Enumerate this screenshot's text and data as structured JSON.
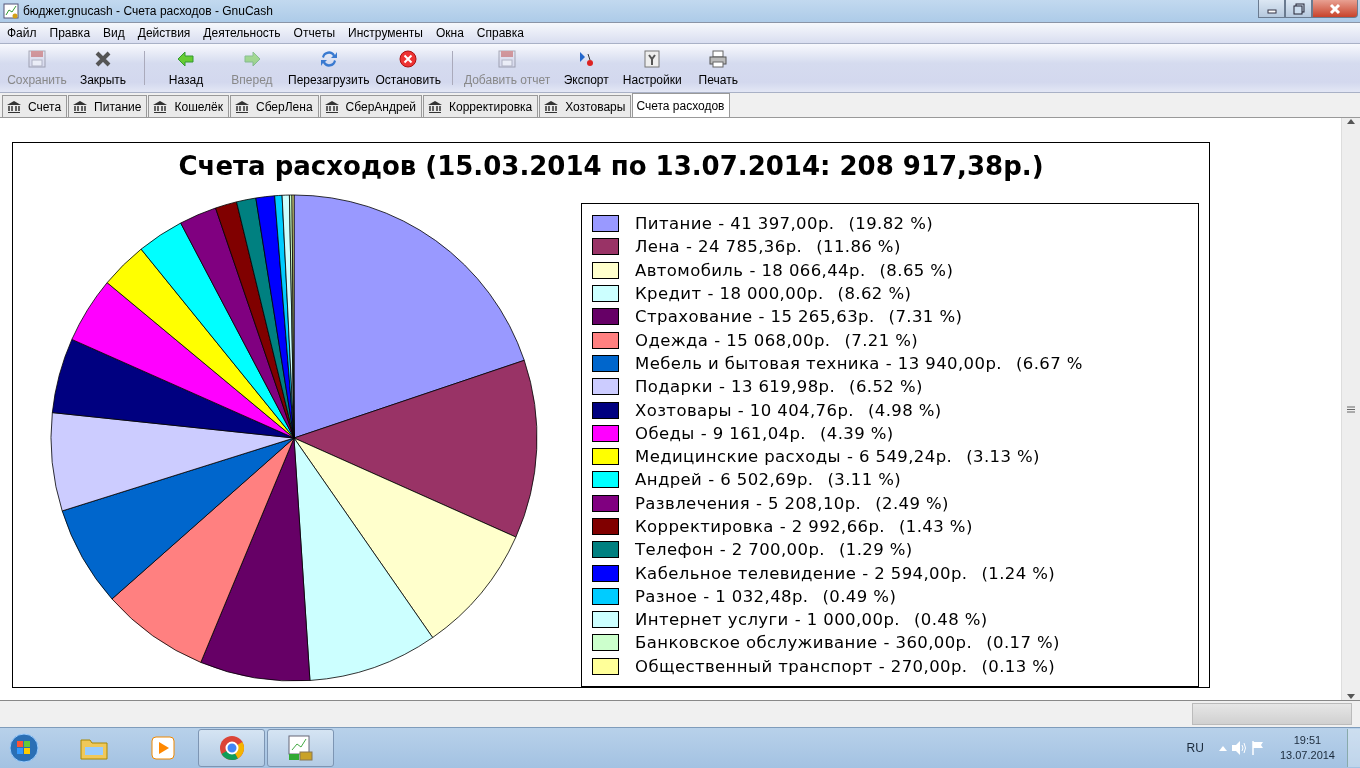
{
  "window": {
    "title": "бюджет.gnucash - Счета расходов - GnuCash"
  },
  "menu": [
    {
      "label": "Файл"
    },
    {
      "label": "Правка"
    },
    {
      "label": "Вид"
    },
    {
      "label": "Действия"
    },
    {
      "label": "Деятельность"
    },
    {
      "label": "Отчеты"
    },
    {
      "label": "Инструменты"
    },
    {
      "label": "Окна"
    },
    {
      "label": "Справка"
    }
  ],
  "toolbar": [
    {
      "label": "Сохранить",
      "kind": "save",
      "disabled": true
    },
    {
      "label": "Закрыть",
      "kind": "close",
      "disabled": false,
      "separator_after": true
    },
    {
      "label": "Назад",
      "kind": "back",
      "disabled": false
    },
    {
      "label": "Вперед",
      "kind": "forward",
      "disabled": true
    },
    {
      "label": "Перезагрузить",
      "kind": "reload",
      "disabled": false
    },
    {
      "label": "Остановить",
      "kind": "stop",
      "disabled": false,
      "separator_after": true
    },
    {
      "label": "Добавить отчет",
      "kind": "save",
      "disabled": true
    },
    {
      "label": "Экспорт",
      "kind": "export",
      "disabled": false
    },
    {
      "label": "Настройки",
      "kind": "options",
      "disabled": false
    },
    {
      "label": "Печать",
      "kind": "print",
      "disabled": false
    }
  ],
  "tabs": [
    {
      "label": "Счета",
      "kind": "account",
      "selected": false
    },
    {
      "label": "Питание",
      "kind": "account",
      "selected": false
    },
    {
      "label": "Кошелёк",
      "kind": "account",
      "selected": false
    },
    {
      "label": "СберЛена",
      "kind": "account",
      "selected": false
    },
    {
      "label": "СберАндрей",
      "kind": "account",
      "selected": false
    },
    {
      "label": "Корректировка",
      "kind": "account",
      "selected": false
    },
    {
      "label": "Хозтовары",
      "kind": "account",
      "selected": false
    },
    {
      "label": "Счета расходов",
      "kind": "report",
      "selected": true
    }
  ],
  "report": {
    "chart_data": {
      "type": "pie",
      "title": "Счета расходов (15.03.2014 по 13.07.2014: 208 917,38р.)",
      "categories": [
        "Питание",
        "Лена",
        "Автомобиль",
        "Кредит",
        "Страхование",
        "Одежда",
        "Мебель и бытовая техника",
        "Подарки",
        "Хозтовары",
        "Обеды",
        "Медицинские расходы",
        "Андрей",
        "Развлечения",
        "Корректировка",
        "Телефон",
        "Кабельное телевидение",
        "Разное",
        "Интернет услуги",
        "Банковское обслуживание",
        "Общественный транспорт"
      ],
      "legend": "right",
      "values": [
        19.82,
        11.86,
        8.65,
        8.62,
        7.31,
        7.21,
        6.67,
        6.52,
        4.98,
        4.39,
        3.13,
        3.11,
        2.49,
        1.43,
        1.29,
        1.24,
        0.49,
        0.48,
        0.17,
        0.13
      ]
    },
    "legend": [
      {
        "amount": "- 41 397,00р.",
        "percent": "(19.82 %)",
        "color": "#9999ff"
      },
      {
        "amount": "- 24 785,36р.",
        "percent": "(11.86 %)",
        "color": "#993366"
      },
      {
        "amount": "- 18 066,44р.",
        "percent": "(8.65 %)",
        "color": "#ffffcc"
      },
      {
        "amount": "- 18 000,00р.",
        "percent": "(8.62 %)",
        "color": "#ccffff"
      },
      {
        "amount": "- 15 265,63р.",
        "percent": "(7.31 %)",
        "color": "#660066"
      },
      {
        "amount": "- 15 068,00р.",
        "percent": "(7.21 %)",
        "color": "#ff8080"
      },
      {
        "amount": "- 13 940,00р.",
        "percent": "(6.67 %",
        "color": "#0066cc"
      },
      {
        "amount": "- 13 619,98р.",
        "percent": "(6.52 %)",
        "color": "#ccccff"
      },
      {
        "amount": "- 10 404,76р.",
        "percent": "(4.98 %)",
        "color": "#000080"
      },
      {
        "amount": "- 9 161,04р.",
        "percent": "(4.39 %)",
        "color": "#ff00ff"
      },
      {
        "amount": "- 6 549,24р.",
        "percent": "(3.13 %)",
        "color": "#ffff00"
      },
      {
        "amount": "- 6 502,69р.",
        "percent": "(3.11 %)",
        "color": "#00ffff"
      },
      {
        "amount": "- 5 208,10р.",
        "percent": "(2.49 %)",
        "color": "#800080"
      },
      {
        "amount": "- 2 992,66р.",
        "percent": "(1.43 %)",
        "color": "#800000"
      },
      {
        "amount": "- 2 700,00р.",
        "percent": "(1.29 %)",
        "color": "#008080"
      },
      {
        "amount": "- 2 594,00р.",
        "percent": "(1.24 %)",
        "color": "#0000ff"
      },
      {
        "amount": "- 1 032,48р.",
        "percent": "(0.49 %)",
        "color": "#00ccff"
      },
      {
        "amount": "- 1 000,00р.",
        "percent": "(0.48 %)",
        "color": "#ccffff"
      },
      {
        "amount": "- 360,00р.",
        "percent": "(0.17 %)",
        "color": "#ccffcc"
      },
      {
        "amount": "- 270,00р.",
        "percent": "(0.13 %)",
        "color": "#ffff99"
      }
    ]
  },
  "taskbar": {
    "apps": [
      {
        "kind": "folder",
        "running": false
      },
      {
        "kind": "media",
        "running": false
      },
      {
        "kind": "browser",
        "running": true
      },
      {
        "kind": "finance",
        "running": true
      }
    ],
    "language": "RU",
    "time": "19:51",
    "date": "13.07.2014"
  }
}
